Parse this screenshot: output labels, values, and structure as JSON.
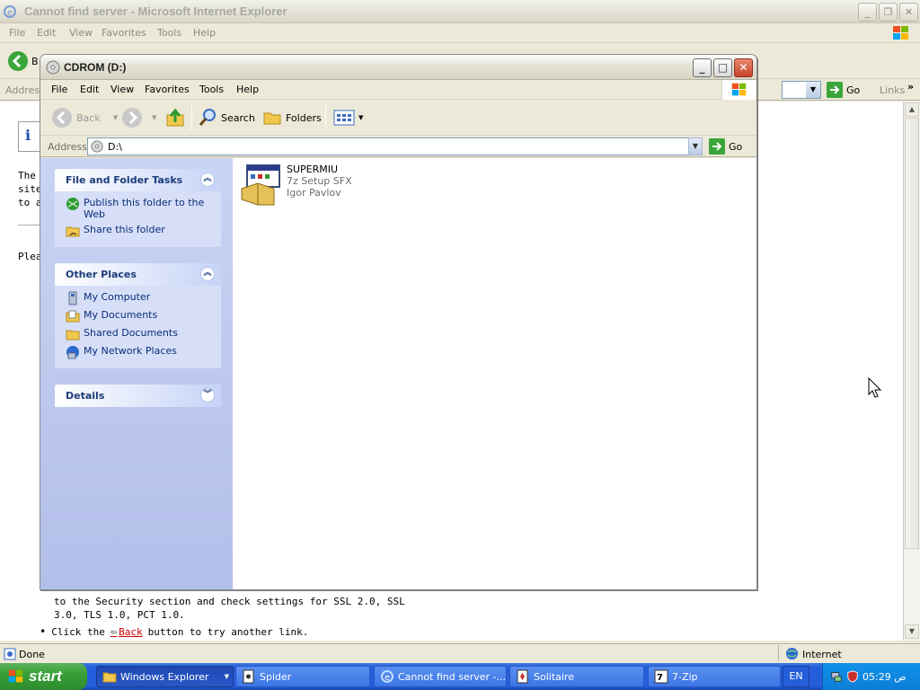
{
  "ie": {
    "title": "Cannot find server - Microsoft Internet Explorer",
    "menu": [
      "File",
      "Edit",
      "View",
      "Favorites",
      "Tools",
      "Help"
    ],
    "toolbar_back_label": "B",
    "address_label": "Address",
    "go_label": "Go",
    "links_label": "Links",
    "content": {
      "line1": "The",
      "line2": "site",
      "line3": "to a",
      "line4": "Plea",
      "security_line1": "to the Security section and check settings for SSL 2.0, SSL",
      "security_line2": "3.0, TLS 1.0, PCT 1.0.",
      "click_prefix": "Click the",
      "back_link": "Back",
      "click_suffix": "button to try another link."
    },
    "status": {
      "text": "Done",
      "zone": "Internet"
    }
  },
  "explorer": {
    "title": "CDROM (D:)",
    "menu": [
      "File",
      "Edit",
      "View",
      "Favorites",
      "Tools",
      "Help"
    ],
    "toolbar": {
      "back": "Back",
      "search": "Search",
      "folders": "Folders"
    },
    "address": {
      "label": "Address",
      "value": "D:\\",
      "go": "Go"
    },
    "task_pane": {
      "file_tasks": {
        "title": "File and Folder Tasks",
        "items": [
          {
            "label": "Publish this folder to the Web",
            "icon": "publish-web-icon"
          },
          {
            "label": "Share this folder",
            "icon": "share-folder-icon"
          }
        ]
      },
      "other_places": {
        "title": "Other Places",
        "items": [
          {
            "label": "My Computer",
            "icon": "my-computer-icon"
          },
          {
            "label": "My Documents",
            "icon": "my-documents-icon"
          },
          {
            "label": "Shared Documents",
            "icon": "shared-documents-icon"
          },
          {
            "label": "My Network Places",
            "icon": "network-places-icon"
          }
        ]
      },
      "details": {
        "title": "Details"
      }
    },
    "files": [
      {
        "name": "SUPERMIU",
        "type": "7z Setup SFX",
        "author": "Igor Pavlov",
        "icon": "setup-package-icon"
      }
    ]
  },
  "taskbar": {
    "start": "start",
    "tasks": [
      {
        "label": "Windows Explorer",
        "active": true
      },
      {
        "label": "Spider",
        "active": false
      },
      {
        "label": "Cannot find server -...",
        "active": false
      },
      {
        "label": "Solitaire",
        "active": false
      },
      {
        "label": "7-Zip",
        "active": false
      }
    ],
    "language": "EN",
    "clock": "05:29 ص"
  },
  "colors": {
    "taskbar_blue": "#245edb",
    "start_green": "#379f36",
    "task_pane_blue": "#b2bfe9",
    "link_red": "#cc0000"
  }
}
